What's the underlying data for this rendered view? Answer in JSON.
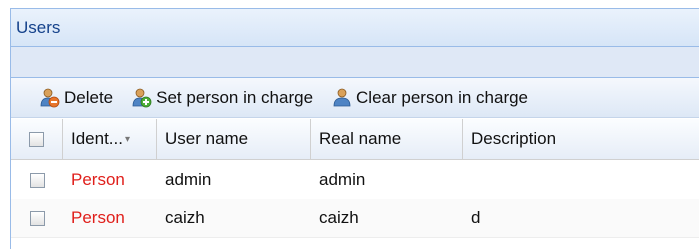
{
  "panel": {
    "title": "Users"
  },
  "toolbar": {
    "delete_label": "Delete",
    "set_person_label": "Set person in charge",
    "clear_person_label": "Clear person in charge"
  },
  "grid": {
    "columns": [
      "Ident...",
      "User name",
      "Real name",
      "Description"
    ],
    "rows": [
      {
        "identity": "Person",
        "user_name": "admin",
        "real_name": "admin",
        "description": ""
      },
      {
        "identity": "Person",
        "user_name": "caizh",
        "real_name": "caizh",
        "description": "d"
      }
    ]
  },
  "colors": {
    "identity_text": "#e0201c",
    "panel_title": "#15428b",
    "border": "#99bbe8"
  },
  "icons": [
    "user-remove-icon",
    "user-add-icon",
    "user-clear-icon",
    "sort-arrow-icon"
  ]
}
